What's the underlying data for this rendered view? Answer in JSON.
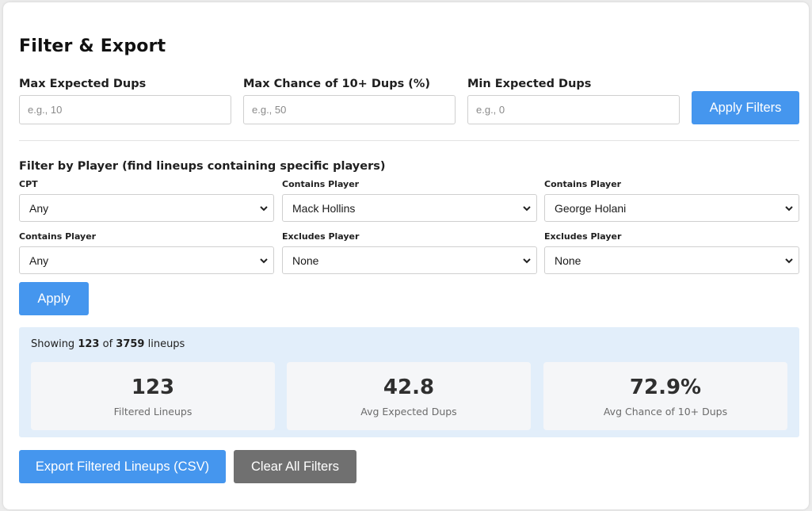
{
  "header": {
    "title": "Filter & Export"
  },
  "dup_filters": [
    {
      "label": "Max Expected Dups",
      "placeholder": "e.g., 10",
      "value": ""
    },
    {
      "label": "Max Chance of 10+ Dups (%)",
      "placeholder": "e.g., 50",
      "value": ""
    },
    {
      "label": "Min Expected Dups",
      "placeholder": "e.g., 0",
      "value": ""
    }
  ],
  "apply_filters_label": "Apply Filters",
  "player_filter": {
    "title": "Filter by Player (find lineups containing specific players)",
    "selects": [
      {
        "label": "CPT",
        "value": "Any"
      },
      {
        "label": "Contains Player",
        "value": "Mack Hollins"
      },
      {
        "label": "Contains Player",
        "value": "George Holani"
      },
      {
        "label": "Contains Player",
        "value": "Any"
      },
      {
        "label": "Excludes Player",
        "value": "None"
      },
      {
        "label": "Excludes Player",
        "value": "None"
      }
    ],
    "apply_label": "Apply"
  },
  "summary": {
    "showing_prefix": "Showing",
    "shown_count": "123",
    "of_word": "of",
    "total_count": "3759",
    "suffix": "lineups",
    "cards": [
      {
        "value": "123",
        "label": "Filtered Lineups"
      },
      {
        "value": "42.8",
        "label": "Avg Expected Dups"
      },
      {
        "value": "72.9%",
        "label": "Avg Chance of 10+ Dups"
      }
    ]
  },
  "actions": {
    "export_label": "Export Filtered Lineups (CSV)",
    "clear_label": "Clear All Filters"
  },
  "colors": {
    "primary": "#4596ee",
    "secondary": "#707070",
    "summary_bg": "#e2eefa",
    "card_bg": "#f5f6f8"
  },
  "icons": {
    "select_arrow": "chevron-down-icon"
  }
}
